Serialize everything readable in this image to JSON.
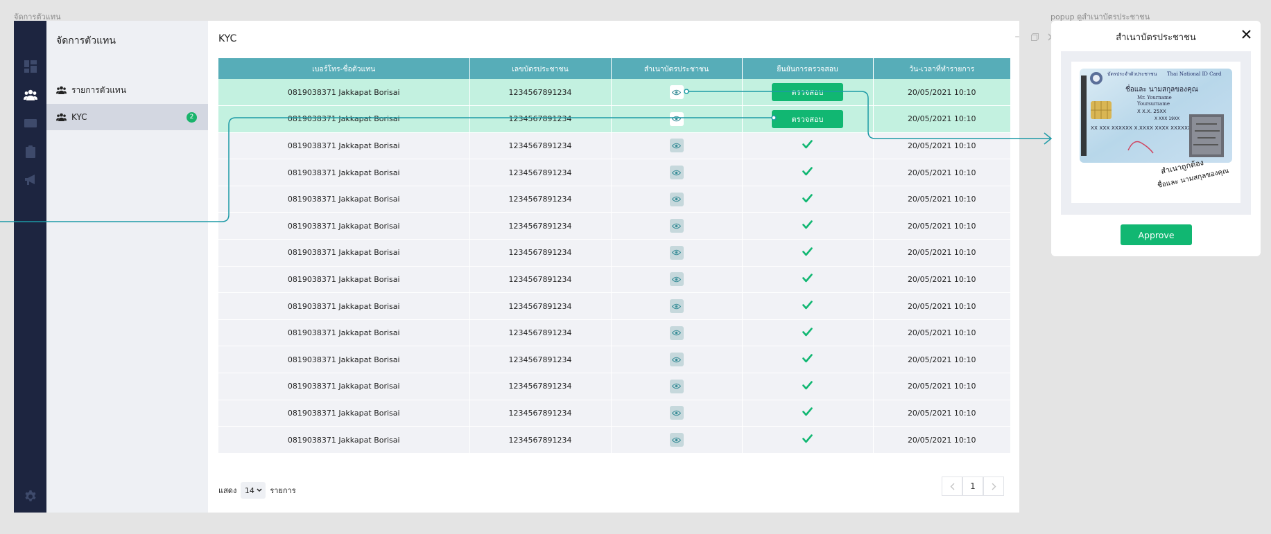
{
  "canvas": {
    "main_label": "จัดการตัวแทน",
    "popup_label": "popup ดูสำเนาบัตรประชาชน"
  },
  "sidebar": {
    "title": "จัดการตัวแทน",
    "items": [
      {
        "label": "รายการตัวแทน",
        "icon": "users-icon"
      },
      {
        "label": "KYC",
        "icon": "users-icon",
        "badge": "2"
      }
    ],
    "icons": [
      "dashboard-icon",
      "users-icon",
      "card-icon",
      "clipboard-icon",
      "megaphone-icon",
      "gear-icon"
    ]
  },
  "page": {
    "title": "KYC",
    "columns": [
      "เบอร์โทร-ชื่อตัวแทน",
      "เลขบัตรประชาชน",
      "สำเนาบัตรประชาชน",
      "ยืนยันการตรวจสอบ",
      "วัน-เวลาที่ทำรายการ"
    ],
    "rows": [
      {
        "name": "0819038371 Jakkapat Borisai",
        "id_no": "1234567891234",
        "status": "pending",
        "datetime": "20/05/2021 10:10"
      },
      {
        "name": "0819038371 Jakkapat Borisai",
        "id_no": "1234567891234",
        "status": "pending",
        "datetime": "20/05/2021 10:10"
      },
      {
        "name": "0819038371 Jakkapat Borisai",
        "id_no": "1234567891234",
        "status": "verified",
        "datetime": "20/05/2021 10:10"
      },
      {
        "name": "0819038371 Jakkapat Borisai",
        "id_no": "1234567891234",
        "status": "verified",
        "datetime": "20/05/2021 10:10"
      },
      {
        "name": "0819038371 Jakkapat Borisai",
        "id_no": "1234567891234",
        "status": "verified",
        "datetime": "20/05/2021 10:10"
      },
      {
        "name": "0819038371 Jakkapat Borisai",
        "id_no": "1234567891234",
        "status": "verified",
        "datetime": "20/05/2021 10:10"
      },
      {
        "name": "0819038371 Jakkapat Borisai",
        "id_no": "1234567891234",
        "status": "verified",
        "datetime": "20/05/2021 10:10"
      },
      {
        "name": "0819038371 Jakkapat Borisai",
        "id_no": "1234567891234",
        "status": "verified",
        "datetime": "20/05/2021 10:10"
      },
      {
        "name": "0819038371 Jakkapat Borisai",
        "id_no": "1234567891234",
        "status": "verified",
        "datetime": "20/05/2021 10:10"
      },
      {
        "name": "0819038371 Jakkapat Borisai",
        "id_no": "1234567891234",
        "status": "verified",
        "datetime": "20/05/2021 10:10"
      },
      {
        "name": "0819038371 Jakkapat Borisai",
        "id_no": "1234567891234",
        "status": "verified",
        "datetime": "20/05/2021 10:10"
      },
      {
        "name": "0819038371 Jakkapat Borisai",
        "id_no": "1234567891234",
        "status": "verified",
        "datetime": "20/05/2021 10:10"
      },
      {
        "name": "0819038371 Jakkapat Borisai",
        "id_no": "1234567891234",
        "status": "verified",
        "datetime": "20/05/2021 10:10"
      },
      {
        "name": "0819038371 Jakkapat Borisai",
        "id_no": "1234567891234",
        "status": "verified",
        "datetime": "20/05/2021 10:10"
      }
    ],
    "verify_label": "ตรวจสอบ",
    "footer": {
      "show_label": "แสดง",
      "page_size": "14",
      "items_label": "รายการ"
    },
    "pagination": {
      "current": "1",
      "prev_icon": "chevron-left-icon",
      "next_icon": "chevron-right-icon"
    }
  },
  "popup": {
    "title": "สำเนาบัตรประชาชน",
    "close_icon": "close-icon",
    "approve_label": "Approve",
    "id_card": {
      "header_th": "บัตรประจำตัวประชาชน",
      "header_en": "Thai National ID Card",
      "name_th": "ชื่อและ นามสกุลของคุณ",
      "name_en": "Mr. Yourname",
      "lastname_en": "Yoursurname",
      "birth_th": "X X.X. 25XX",
      "birth_en": "X XXX 19XX",
      "address": "XX XXX XXXXXX X.XXXX XXXX XXXXXXX",
      "handwriting_1": "สำเนาถูกต้อง",
      "handwriting_2": "ชื่อและ นามสกุลของคุณ"
    }
  },
  "colors": {
    "header": "#57adb8",
    "pending_row": "#c3f1e0",
    "accent": "#11b772",
    "sidebar": "#1d2540",
    "connector": "#1d9aa6"
  }
}
